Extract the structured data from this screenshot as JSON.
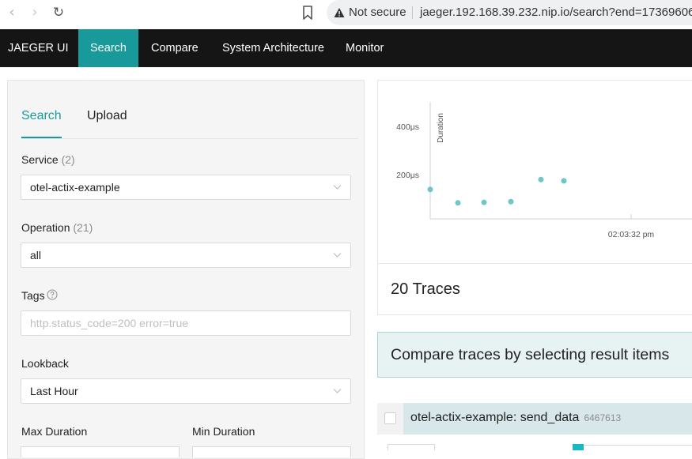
{
  "browser": {
    "back_icon": "chevron-left-icon",
    "forward_icon": "chevron-right-icon",
    "reload_icon": "reload-icon",
    "bookmark_icon": "bookmark-icon",
    "security_icon": "warning-triangle-icon",
    "security_label": "Not secure",
    "url": "jaeger.192.168.39.232.nip.io/search?end=17369606"
  },
  "nav": {
    "brand": "JAEGER UI",
    "items": [
      "Search",
      "Compare",
      "System Architecture",
      "Monitor"
    ],
    "active": "Search",
    "accent": "#199a9a"
  },
  "search_panel": {
    "tabs": [
      "Search",
      "Upload"
    ],
    "active_tab": "Search",
    "service": {
      "label": "Service",
      "count": "(2)",
      "value": "otel-actix-example"
    },
    "operation": {
      "label": "Operation",
      "count": "(21)",
      "value": "all"
    },
    "tags": {
      "label": "Tags",
      "placeholder": "http.status_code=200 error=true",
      "icon": "question-circle-icon"
    },
    "lookback": {
      "label": "Lookback",
      "value": "Last Hour"
    },
    "max_duration_label": "Max Duration",
    "min_duration_label": "Min Duration"
  },
  "chart_data": {
    "type": "scatter",
    "title": "",
    "xlabel": "",
    "ylabel": "Duration",
    "y_ticks": [
      "400μs",
      "200μs"
    ],
    "x_ticks": [
      "02:03:32 pm"
    ],
    "ylim_us": [
      0,
      470
    ],
    "points_y_us": [
      120,
      65,
      67,
      70,
      160,
      155
    ],
    "point_color": "#6ec6c6"
  },
  "results": {
    "count_label": "20 Traces",
    "compare_hint": "Compare traces by selecting result items",
    "first": {
      "title": "otel-actix-example: send_data",
      "id": "6467613"
    }
  }
}
